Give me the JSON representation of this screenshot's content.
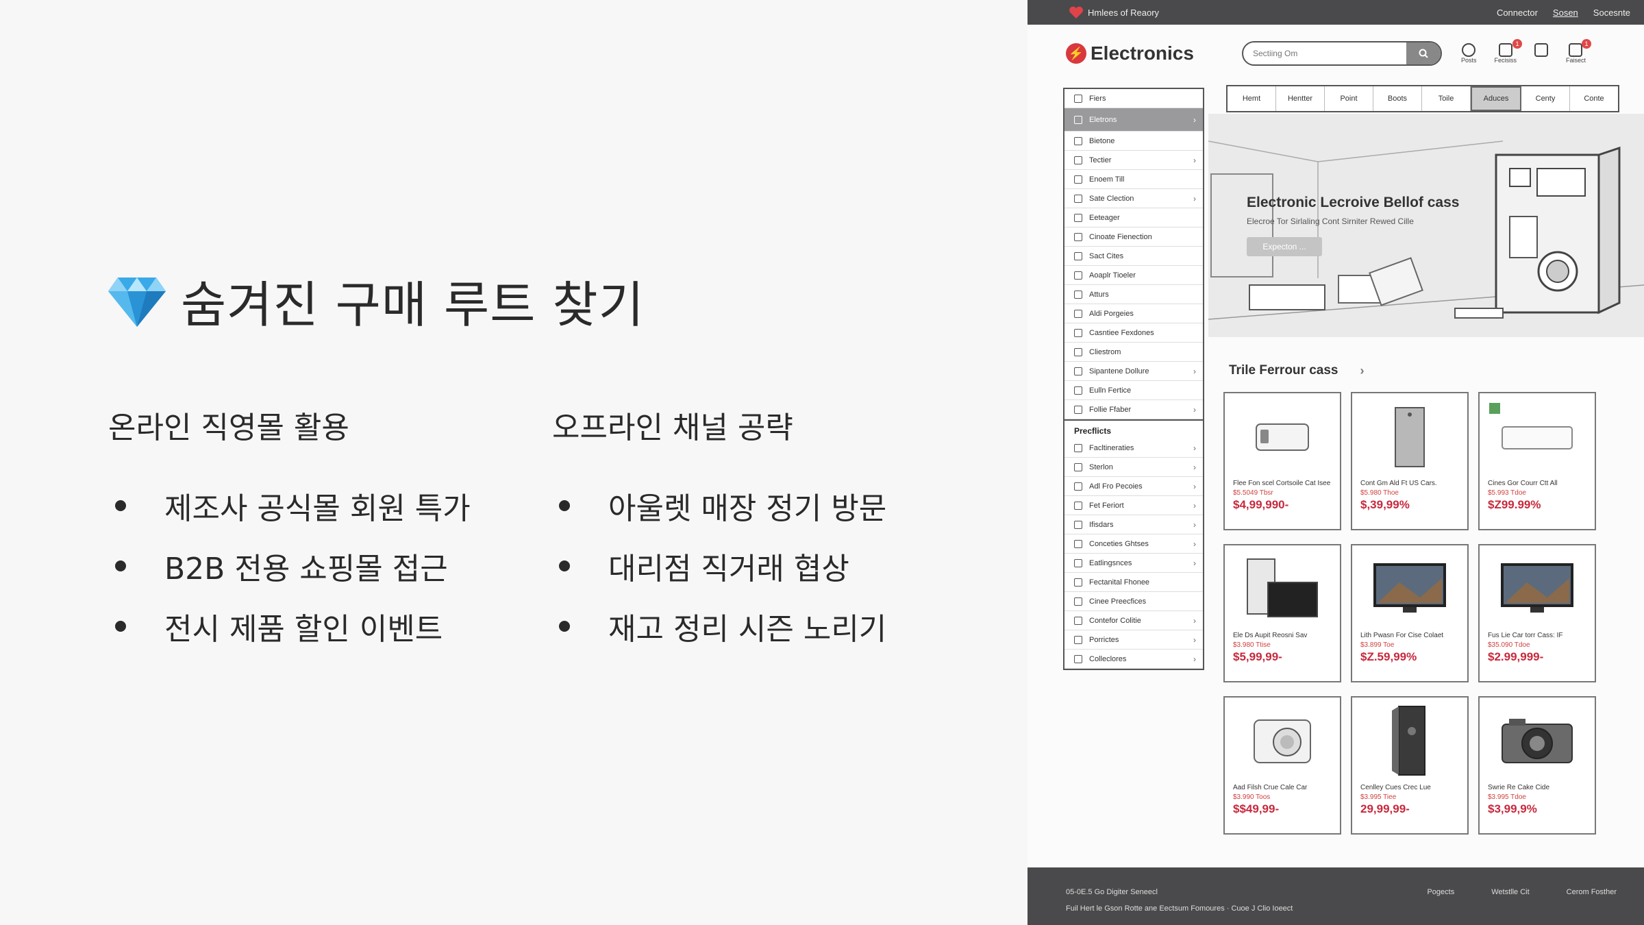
{
  "slide": {
    "title": "숨겨진 구매 루트 찾기",
    "columns": [
      {
        "heading": "온라인 직영몰 활용",
        "items": [
          "제조사 공식몰 회원 특가",
          "B2B 전용 쇼핑몰 접근",
          "전시 제품 할인 이벤트"
        ]
      },
      {
        "heading": "오프라인 채널 공략",
        "items": [
          "아울렛 매장 정기 방문",
          "대리점 직거래 협상",
          "재고 정리 시즌 노리기"
        ]
      }
    ]
  },
  "site": {
    "topbar": {
      "brand": "Hmlees of Reaory",
      "links": [
        "Connector",
        "Sosen",
        "Socesnte"
      ]
    },
    "logo": "Electronics",
    "search_placeholder": "Sectiing Om",
    "header_icons": [
      {
        "label": "Posts",
        "badge": ""
      },
      {
        "label": "Fecisiss",
        "badge": "1"
      },
      {
        "label": "",
        "badge": ""
      },
      {
        "label": "Faisect",
        "badge": "1"
      }
    ],
    "nav": [
      "Hemt",
      "Hentter",
      "Point",
      "Boots",
      "Toile",
      "Aduces",
      "Centy",
      "Conte"
    ],
    "nav_selected": 5,
    "sidebar": {
      "top": "Fiers",
      "active": "Eletrons",
      "items": [
        {
          "label": "Bietone",
          "chev": false
        },
        {
          "label": "Tectier",
          "chev": true
        },
        {
          "label": "Enoem Till",
          "chev": false
        },
        {
          "label": "Sate Clection",
          "chev": true
        },
        {
          "label": "Eeteager",
          "chev": false
        },
        {
          "label": "Cinoate Fienection",
          "chev": false
        },
        {
          "label": "Sact Cites",
          "chev": false
        },
        {
          "label": "Aoaplr Tioeler",
          "chev": false
        },
        {
          "label": "Atturs",
          "chev": false
        },
        {
          "label": "Aldi Porgeies",
          "chev": false
        },
        {
          "label": "Casntiee Fexdones",
          "chev": false
        },
        {
          "label": "Cliestrom",
          "chev": false
        },
        {
          "label": "Sipantene Dollure",
          "chev": true
        },
        {
          "label": "Eulln Fertice",
          "chev": false
        },
        {
          "label": "Follie Ffaber",
          "chev": true
        }
      ],
      "head2": "Precflicts",
      "items2": [
        {
          "label": "Facltineraties",
          "chev": true
        },
        {
          "label": "Sterlon",
          "chev": true
        },
        {
          "label": "Adl Fro Pecoies",
          "chev": true
        },
        {
          "label": "Fet Feriort",
          "chev": true
        },
        {
          "label": "Ifisdars",
          "chev": true
        },
        {
          "label": "Conceties Ghtses",
          "chev": true
        },
        {
          "label": "Eatlingsnces",
          "chev": true
        },
        {
          "label": "Fectanital Fhonee",
          "chev": false
        },
        {
          "label": "Cinee Preecfices",
          "chev": false
        },
        {
          "label": "Contefor Colitie",
          "chev": true
        },
        {
          "label": "Porrictes",
          "chev": true
        },
        {
          "label": "Colleclores",
          "chev": true
        }
      ]
    },
    "hero": {
      "title": "Electronic Lecroive Bellof cass",
      "subtitle": "Elecroe Tor Sirlaling Cont Sirniter Rewed Cille",
      "button": "Expecton ..."
    },
    "section_title": "Trile Ferrour cass",
    "products": [
      {
        "name": "Flee Fon scel Cortsoile Cat Isee",
        "old": "$5.5049 Tbsr",
        "price": "$4,99,990-",
        "img": "router"
      },
      {
        "name": "Cont Gm Ald Ft US Cars.",
        "old": "$5.980 Thoe",
        "price": "$,39,99%",
        "img": "tower"
      },
      {
        "name": "Cines Gor Courr Ctt All",
        "old": "$5.993 Tdoe",
        "price": "$Z99.99%",
        "img": "router2"
      },
      {
        "name": "Ele Ds Aupit Reosni Sav",
        "old": "$3.980 Ttise",
        "price": "$5,99,99-",
        "img": "tvbox"
      },
      {
        "name": "Lith Pwasn For Cise Colaet",
        "old": "$3.899 Toe",
        "price": "$Z.59,99%",
        "img": "tv"
      },
      {
        "name": "Fus Lie Car torr Cass: IF",
        "old": "$35.090 Tdoe",
        "price": "$2.99,999-",
        "img": "tv"
      },
      {
        "name": "Aad Filsh Crue Cale Car",
        "old": "$3.990 Toos",
        "price": "$$49,99-",
        "img": "washer"
      },
      {
        "name": "Cenlley Cues Crec Lue",
        "old": "$3.995 Tiee",
        "price": "29,99,99-",
        "img": "speaker"
      },
      {
        "name": "Swrie Re Cake Cide",
        "old": "$3.995 Tdoe",
        "price": "$3,99,9%",
        "img": "camera"
      }
    ],
    "footer": {
      "line1": "05-0E.5 Go Digiter Seneecl",
      "line2": "Fuil Hert le Gson Rotte  ane Eectsum Fomoures · Cuoe J Clio Ioeect",
      "links": [
        "Pogects",
        "Wetstlle Cit",
        "Cerom Fosther"
      ]
    }
  },
  "colors": {
    "accent": "#c8283c",
    "chrome": "#4a4a4c",
    "active": "#9a9a9c"
  }
}
